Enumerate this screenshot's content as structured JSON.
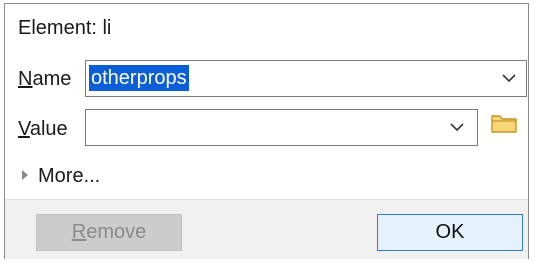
{
  "dialog": {
    "title": "Element: li",
    "name_label_accel": "N",
    "name_label_rest": "ame",
    "name_value": "otherprops",
    "value_label_accel": "V",
    "value_label_rest": "alue",
    "value_value": "",
    "more_label": "More...",
    "remove_label_accel": "R",
    "remove_label_rest": "emove",
    "ok_label": "OK"
  },
  "icons": {
    "name_dropdown": "chevron-down-icon",
    "value_dropdown": "chevron-down-icon",
    "browse": "folder-icon",
    "more_expander": "triangle-right-icon"
  },
  "colors": {
    "selection": "#0a5fd8",
    "primary_border": "#2f7fd1",
    "folder": "#e8b94a"
  }
}
